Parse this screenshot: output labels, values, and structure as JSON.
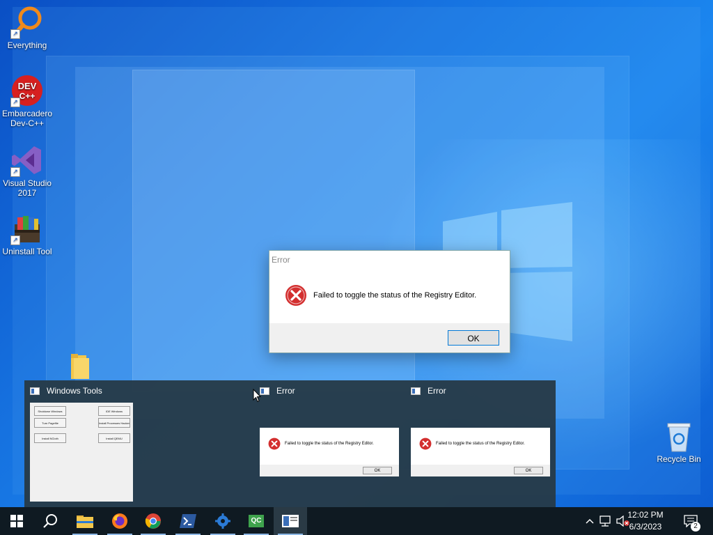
{
  "desktop": {
    "icons": [
      {
        "label": "Everything"
      },
      {
        "label": "Embarcadero Dev-C++"
      },
      {
        "label": "Visual Studio 2017"
      },
      {
        "label": "Uninstall Tool"
      },
      {
        "label": "Recycle Bin"
      }
    ],
    "dev_logo_text": "DEV C++"
  },
  "dialog": {
    "title": "Error",
    "message": "Failed to toggle the status of the Registry Editor.",
    "ok_label": "OK"
  },
  "thumbnails": [
    {
      "title": "Windows Tools",
      "buttons": [
        "Shutdown Windows",
        "Turn Pagefile",
        "Install NCloth",
        "IDE Windows",
        "Install Processes Hacker",
        "Install QEMU"
      ]
    },
    {
      "title": "Error",
      "message": "Failed to toggle the status of the Registry Editor.",
      "ok_label": "OK"
    },
    {
      "title": "Error",
      "message": "Failed to toggle the status of the Registry Editor.",
      "ok_label": "OK"
    }
  ],
  "taskbar": {
    "apps": [
      "start-icon",
      "search-icon",
      "file-explorer-icon",
      "firefox-icon",
      "chrome-icon",
      "powershell-icon",
      "settings-icon",
      "qc-icon",
      "windows-tools-icon"
    ],
    "qc_label": "QC",
    "clock_time": "12:02 PM",
    "clock_date": "6/3/2023",
    "notification_count": "2"
  },
  "colors": {
    "accent": "#0078d7",
    "error_red": "#d32f2f",
    "taskbar": "#0f1a22"
  }
}
